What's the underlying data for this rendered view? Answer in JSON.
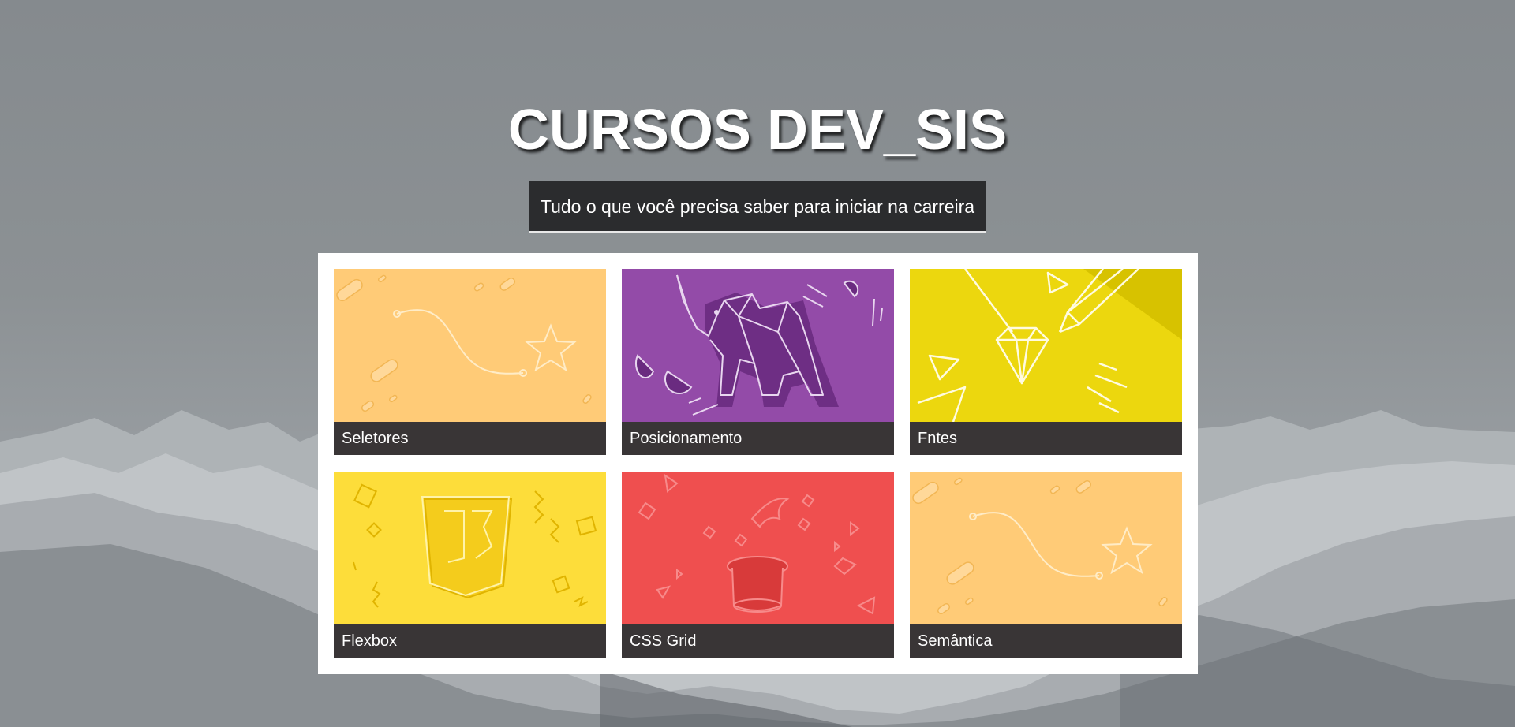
{
  "header": {
    "title": "CURSOS DEV_SIS",
    "subtitle": "Tudo o que você precisa saber para iniciar na carreira"
  },
  "courses": [
    {
      "label": "Seletores",
      "color": "#ffcb77",
      "icon": "shooting-star-illustration"
    },
    {
      "label": "Posicionamento",
      "color": "#934ba8",
      "icon": "origami-elephant-illustration"
    },
    {
      "label": "Fntes",
      "color": "#ecd70e",
      "icon": "diamond-pencil-illustration"
    },
    {
      "label": "Flexbox",
      "color": "#fddd3a",
      "icon": "js-shield-illustration"
    },
    {
      "label": "CSS Grid",
      "color": "#ef4f4f",
      "icon": "magic-hat-illustration"
    },
    {
      "label": "Semântica",
      "color": "#ffcb77",
      "icon": "shooting-star-illustration"
    }
  ],
  "colors": {
    "label_bg": "#393536",
    "subtitle_bg": "#2b2c2e",
    "panel_bg": "#ffffff"
  }
}
